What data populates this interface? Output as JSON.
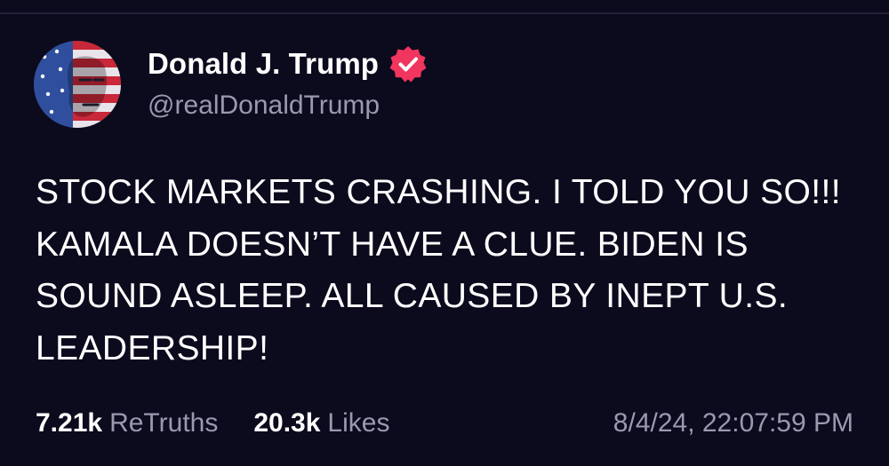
{
  "post": {
    "author": {
      "name": "Donald J. Trump",
      "handle": "@realDonaldTrump",
      "verified": true,
      "avatar_icon": "avatar-flag-portrait",
      "verified_icon": "verified-badge-icon"
    },
    "body": "STOCK MARKETS CRASHING. I TOLD YOU SO!!! KAMALA DOESN’T HAVE A CLUE. BIDEN IS SOUND ASLEEP. ALL CAUSED BY INEPT U.S. LEADERSHIP!",
    "stats": {
      "retruths_count": "7.21k",
      "retruths_label": "ReTruths",
      "likes_count": "20.3k",
      "likes_label": "Likes"
    },
    "timestamp": "8/4/24, 22:07:59 PM"
  },
  "colors": {
    "background": "#0c0a1d",
    "text_primary": "#ffffff",
    "text_secondary": "#9b99b0",
    "verified_badge": "#f0355e",
    "divider": "#23213a"
  }
}
